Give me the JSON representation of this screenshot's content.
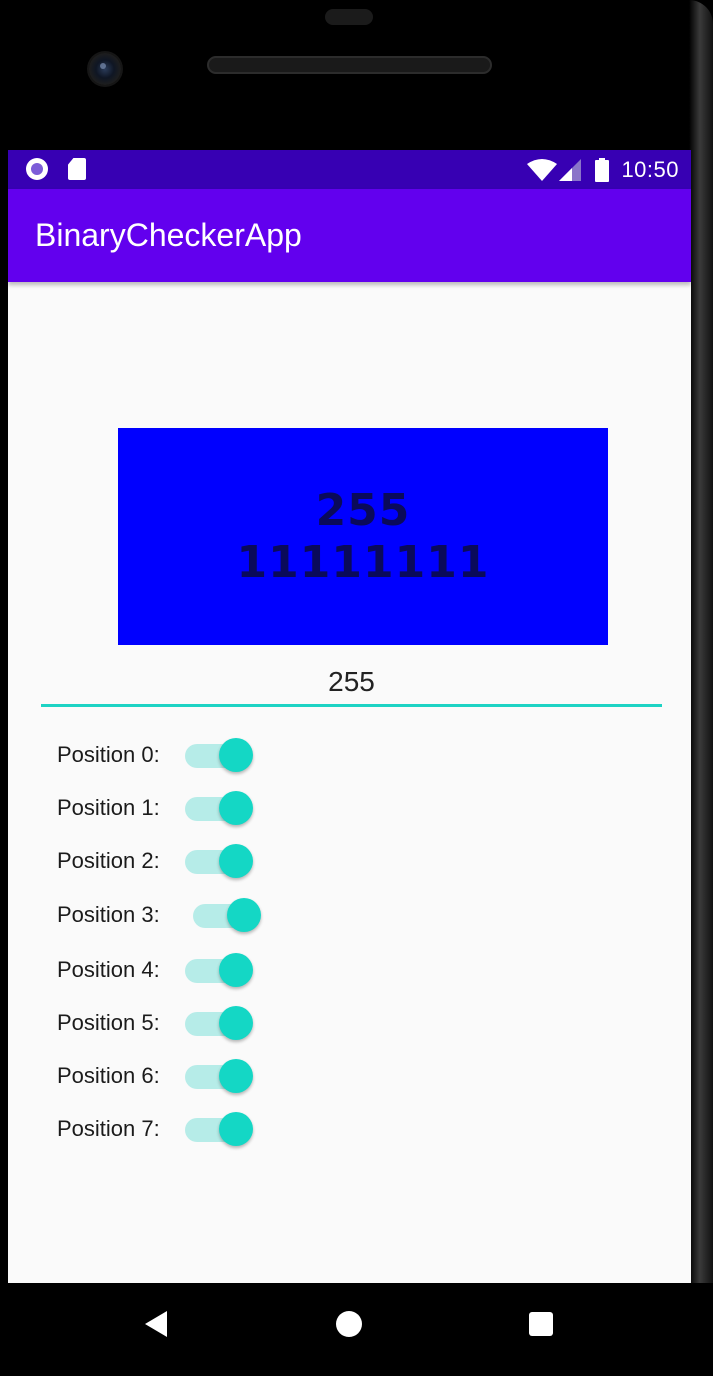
{
  "status_bar": {
    "time": "10:50",
    "left_icons": [
      "recording-circle-icon",
      "sd-card-icon"
    ],
    "right_icons": [
      "wifi-icon",
      "cell-signal-icon",
      "battery-icon"
    ]
  },
  "app_bar": {
    "title": "BinaryCheckerApp"
  },
  "display": {
    "decimal": "255",
    "binary": "11111111",
    "background_color": "#0000ff"
  },
  "input": {
    "value": "255",
    "underline_color": "#1dd3c4"
  },
  "switches": [
    {
      "label": "Position 0:",
      "checked": true
    },
    {
      "label": "Position 1:",
      "checked": true
    },
    {
      "label": "Position 2:",
      "checked": true
    },
    {
      "label": "Position 3:",
      "checked": true
    },
    {
      "label": "Position 4:",
      "checked": true
    },
    {
      "label": "Position 5:",
      "checked": true
    },
    {
      "label": "Position 6:",
      "checked": true
    },
    {
      "label": "Position 7:",
      "checked": true
    }
  ],
  "colors": {
    "status_bar": "#3700b3",
    "app_bar": "#6200ee",
    "accent": "#14d7c5",
    "screen_bg": "#fafafa"
  },
  "nav_bar": {
    "icons": [
      "back-icon",
      "home-icon",
      "recents-icon"
    ]
  }
}
